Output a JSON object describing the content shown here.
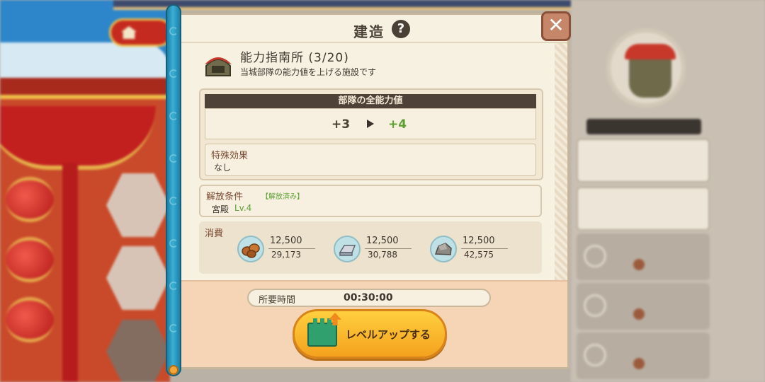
{
  "modal": {
    "title": "建造",
    "help_icon_glyph": "?",
    "close_glyph": "✕",
    "facility": {
      "name": "能力指南所 (3/20)",
      "description": "当城部隊の能力値を上げる施設です",
      "icon": "helmet-icon"
    },
    "stats": {
      "header": "部隊の全能力値",
      "current": "+3",
      "next": "+4",
      "special_label": "特殊効果",
      "special_value": "なし"
    },
    "unlock": {
      "label": "解放条件",
      "status": "【解放済み】",
      "building": "宮殿",
      "level": "Lv.4"
    },
    "cost": {
      "label": "消費",
      "resources": [
        {
          "icon": "wood-icon",
          "required": "12,500",
          "owned": "29,173"
        },
        {
          "icon": "iron-icon",
          "required": "12,500",
          "owned": "30,788"
        },
        {
          "icon": "stone-icon",
          "required": "12,500",
          "owned": "42,575"
        }
      ]
    },
    "time": {
      "label": "所要時間",
      "value": "00:30:00"
    },
    "level_up_button": "レベルアップする"
  },
  "colors": {
    "accent_green": "#5ca032",
    "button_orange": "#f4a21d",
    "header_dark": "#4e4137"
  }
}
